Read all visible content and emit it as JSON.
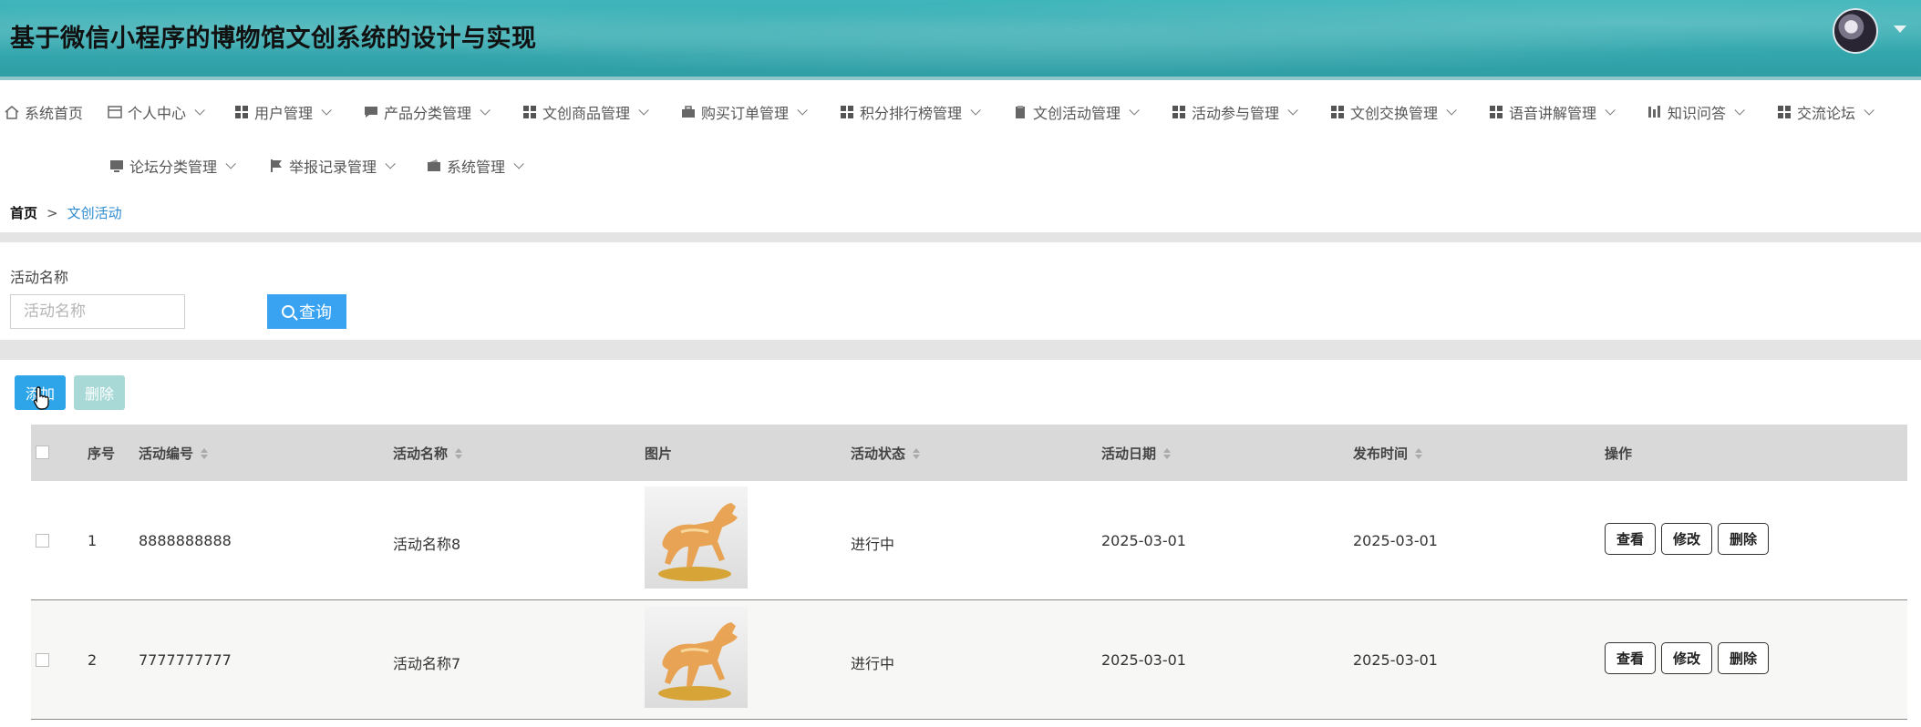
{
  "header": {
    "title": "基于微信小程序的博物馆文创系统的设计与实现"
  },
  "nav": {
    "items": [
      {
        "label": "系统首页",
        "icon": "home-icon"
      },
      {
        "label": "个人中心",
        "icon": "profile-card-icon"
      },
      {
        "label": "用户管理",
        "icon": "grid-icon"
      },
      {
        "label": "产品分类管理",
        "icon": "chat-icon"
      },
      {
        "label": "文创商品管理",
        "icon": "grid-icon"
      },
      {
        "label": "购买订单管理",
        "icon": "briefcase-icon"
      },
      {
        "label": "积分排行榜管理",
        "icon": "grid-icon"
      },
      {
        "label": "文创活动管理",
        "icon": "clipboard-icon"
      },
      {
        "label": "活动参与管理",
        "icon": "grid-icon"
      },
      {
        "label": "文创交换管理",
        "icon": "grid-icon"
      },
      {
        "label": "语音讲解管理",
        "icon": "grid-icon"
      },
      {
        "label": "知识问答",
        "icon": "bar-chart-icon"
      },
      {
        "label": "交流论坛",
        "icon": "grid-icon"
      },
      {
        "label": "论坛分类管理",
        "icon": "monitor-icon"
      },
      {
        "label": "举报记录管理",
        "icon": "flag-icon"
      },
      {
        "label": "系统管理",
        "icon": "wallet-icon"
      }
    ]
  },
  "breadcrumb": {
    "home": "首页",
    "separator": ">",
    "current": "文创活动"
  },
  "search": {
    "label": "活动名称",
    "placeholder": "活动名称",
    "button": "查询"
  },
  "toolbar": {
    "add": "添加",
    "delete": "删除"
  },
  "table": {
    "columns": [
      "序号",
      "活动编号",
      "活动名称",
      "图片",
      "活动状态",
      "活动日期",
      "发布时间",
      "操作"
    ],
    "rows": [
      {
        "index": "1",
        "code": "8888888888",
        "name": "活动名称8",
        "status": "进行中",
        "date": "2025-03-01",
        "published": "2025-03-01"
      },
      {
        "index": "2",
        "code": "7777777777",
        "name": "活动名称7",
        "status": "进行中",
        "date": "2025-03-01",
        "published": "2025-03-01"
      }
    ],
    "actions": {
      "view": "查看",
      "edit": "修改",
      "delete": "删除"
    }
  },
  "colors": {
    "accent": "#3aa3f1",
    "header": "#35aab0",
    "link": "#2e8ccf"
  }
}
